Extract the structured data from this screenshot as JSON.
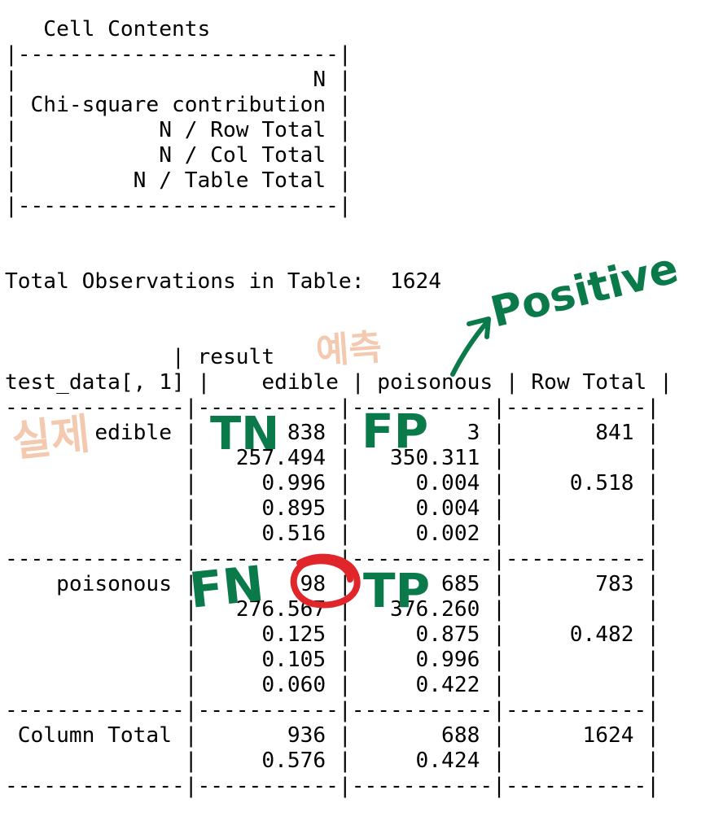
{
  "console": {
    "lines": [
      "   Cell Contents",
      "|-------------------------|",
      "|                       N |",
      "| Chi-square contribution |",
      "|           N / Row Total |",
      "|           N / Col Total |",
      "|         N / Table Total |",
      "|-------------------------|",
      "",
      "",
      "Total Observations in Table:  1624",
      "",
      "",
      "             | result",
      "test_data[, 1] |    edible | poisonous | Row Total |",
      "--------------|-----------|-----------|-----------|",
      "       edible |       838 |         3 |       841 |",
      "              |   257.494 |   350.311 |           |",
      "              |     0.996 |     0.004 |     0.518 |",
      "              |     0.895 |     0.004 |           |",
      "              |     0.516 |     0.002 |           |",
      "--------------|-----------|-----------|-----------|",
      "    poisonous |        98 |       685 |       783 |",
      "              |   276.567 |   376.260 |           |",
      "              |     0.125 |     0.875 |     0.482 |",
      "              |     0.105 |     0.996 |           |",
      "              |     0.060 |     0.422 |           |",
      "--------------|-----------|-----------|-----------|",
      " Column Total |       936 |       688 |      1624 |",
      "              |     0.576 |     0.424 |           |",
      "--------------|-----------|-----------|-----------|"
    ]
  },
  "annotations": {
    "actual_label": "실제",
    "predicted_label": "예측",
    "positive_label": "Positive",
    "tn_label": "TN",
    "fp_label": "FP",
    "fn_label": "FN",
    "tp_label": "TP",
    "green_color": "#0a7a4a",
    "peach_color": "#f3c9b0",
    "red_color": "#e0262a"
  }
}
